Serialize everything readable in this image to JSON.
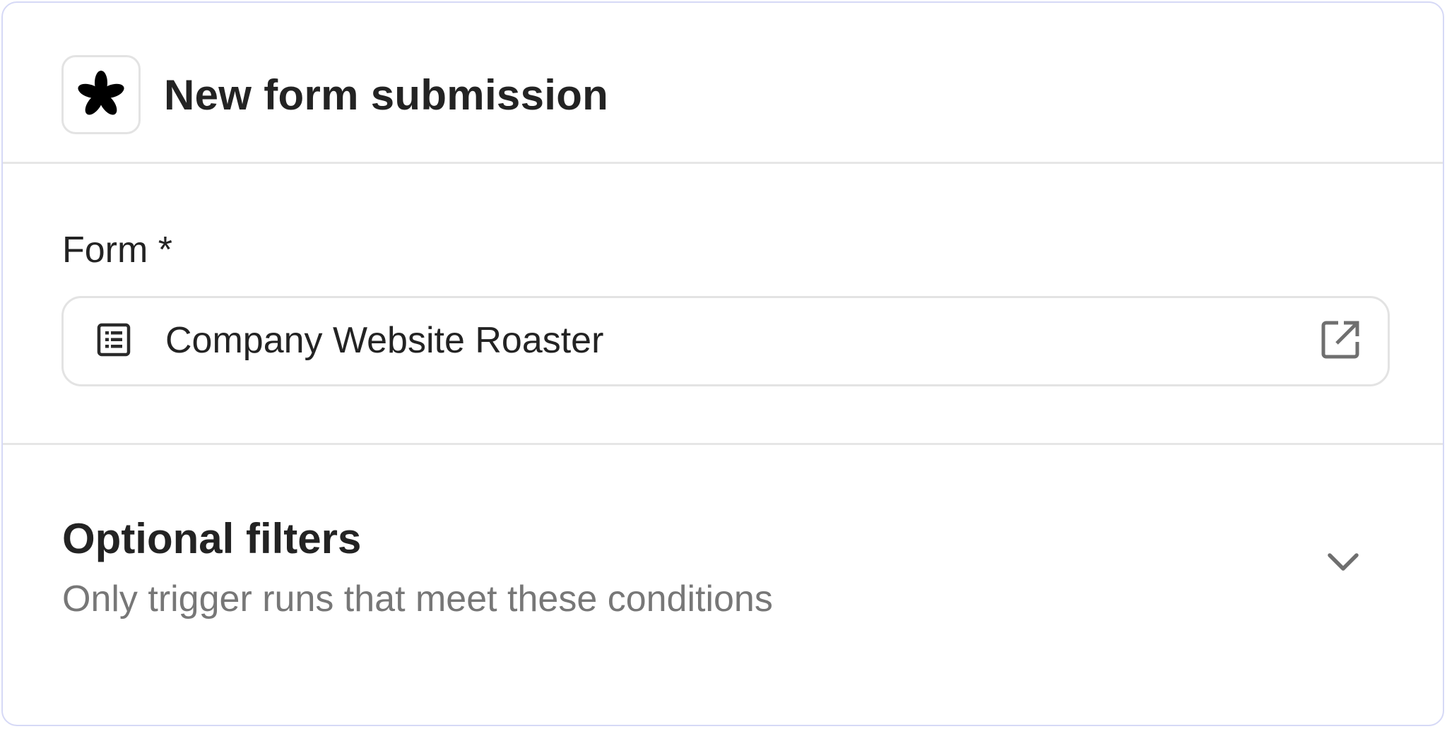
{
  "header": {
    "title": "New form submission",
    "app_icon": "asterisk-icon"
  },
  "form_field": {
    "label": "Form *",
    "value": "Company Website Roaster",
    "leading_icon": "list-icon",
    "trailing_icon": "open-external-icon"
  },
  "filters": {
    "title": "Optional filters",
    "subtitle": "Only trigger runs that meet these conditions",
    "toggle_icon": "chevron-down-icon"
  },
  "colors": {
    "border_accent": "#d6d9f6",
    "divider": "#e6e6e6",
    "text_primary": "#232323",
    "text_secondary": "#777777",
    "icon_gray": "#6f6f6f"
  }
}
